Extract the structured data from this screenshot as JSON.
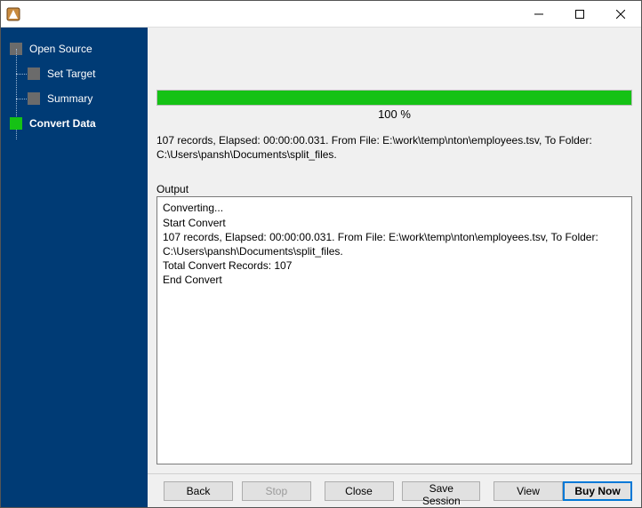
{
  "titlebar": {
    "minimize": "—",
    "maximize": "▢",
    "close": "✕"
  },
  "sidebar": {
    "steps": [
      {
        "label": "Open Source"
      },
      {
        "label": "Set Target"
      },
      {
        "label": "Summary"
      },
      {
        "label": "Convert Data"
      }
    ]
  },
  "progress": {
    "percent_label": "100 %",
    "percent": 100
  },
  "status": {
    "line1": "107 records,   Elapsed: 00:00:00.031.    From File: E:\\work\\temp\\nton\\employees.tsv,    To Folder: C:\\Users\\pansh\\Documents\\split_files."
  },
  "output_label": "Output",
  "output_lines": [
    "Converting...",
    "Start Convert",
    "107 records,   Elapsed: 00:00:00.031.    From File: E:\\work\\temp\\nton\\employees.tsv,    To Folder: C:\\Users\\pansh\\Documents\\split_files.",
    "Total Convert Records: 107",
    "End Convert"
  ],
  "buttons": {
    "back": "Back",
    "stop": "Stop",
    "close": "Close",
    "save_session": "Save Session",
    "view": "View",
    "buy_now": "Buy Now"
  }
}
